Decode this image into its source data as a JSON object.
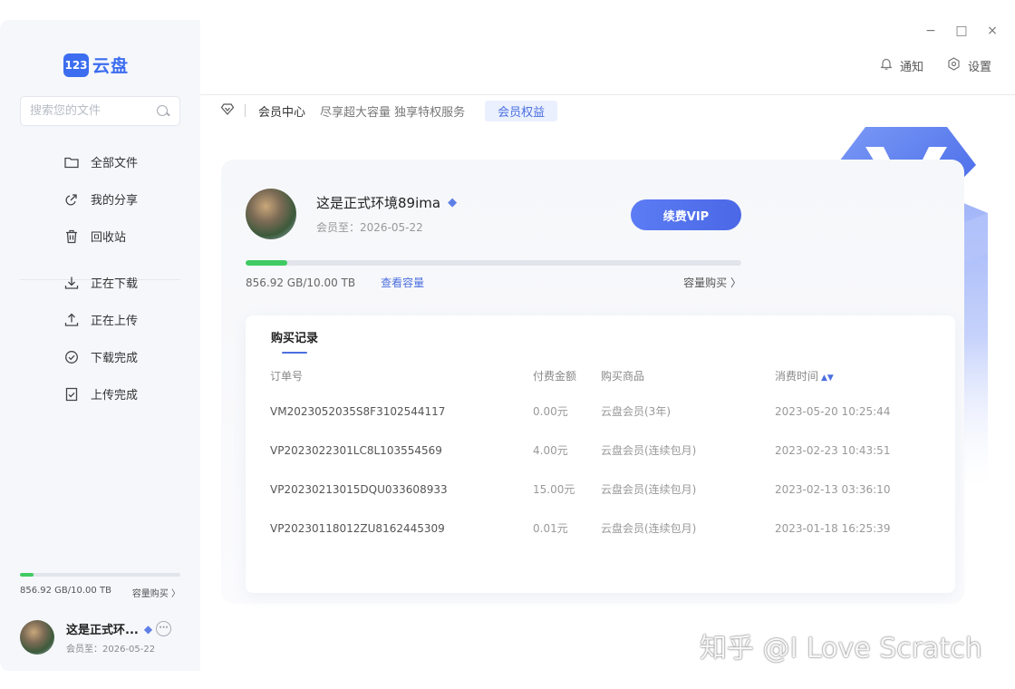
{
  "app": {
    "logo_mark": "123",
    "logo_text": "云盘"
  },
  "window_controls": {
    "minimize": "−",
    "maximize": "□",
    "close": "×"
  },
  "top_actions": {
    "notify_label": "通知",
    "settings_label": "设置"
  },
  "sidebar": {
    "search_placeholder": "搜索您的文件",
    "items": [
      {
        "label": "全部文件",
        "icon": "folder-icon"
      },
      {
        "label": "我的分享",
        "icon": "share-icon"
      },
      {
        "label": "回收站",
        "icon": "trash-icon"
      }
    ],
    "transfer_items": [
      {
        "label": "正在下载",
        "icon": "download-icon"
      },
      {
        "label": "正在上传",
        "icon": "upload-icon"
      },
      {
        "label": "下载完成",
        "icon": "check-circle-icon"
      },
      {
        "label": "上传完成",
        "icon": "check-file-icon"
      }
    ],
    "storage": {
      "used_text": "856.92 GB/10.00 TB",
      "buy_label": "容量购买",
      "fill_fraction": 0.0837
    },
    "user": {
      "name": "这是正式环...",
      "expire": "会员至：2026-05-22"
    }
  },
  "breadcrumb": {
    "title": "会员中心",
    "slogan": "尽享超大容量 独享特权服务",
    "tag": "会员权益"
  },
  "member": {
    "name": "这是正式环境89ima",
    "expire": "会员至：2026-05-22",
    "renew_label": "续费VIP",
    "storage_text": "856.92 GB/10.00 TB",
    "view_capacity_label": "查看容量",
    "buy_capacity_label": "容量购买",
    "fill_fraction": 0.0837
  },
  "records": {
    "tab_label": "购买记录",
    "columns": [
      "订单号",
      "付费金额",
      "购买商品",
      "消费时间"
    ],
    "rows": [
      [
        "VM2023052035S8F3102544117",
        "0.00元",
        "云盘会员(3年)",
        "2023-05-20 10:25:44"
      ],
      [
        "VP2023022301LC8L103554569",
        "4.00元",
        "云盘会员(连续包月)",
        "2023-02-23 10:43:51"
      ],
      [
        "VP20230213015DQU033608933",
        "15.00元",
        "云盘会员(连续包月)",
        "2023-02-13 03:36:10"
      ],
      [
        "VP20230118012ZU8162445309",
        "0.01元",
        "云盘会员(连续包月)",
        "2023-01-18 16:25:39"
      ]
    ]
  },
  "watermark": "知乎 @I Love Scratch",
  "colors": {
    "accent": "#4b6fe0",
    "progress": "#3fcb62",
    "sidebar_bg": "#f5f7fb"
  }
}
